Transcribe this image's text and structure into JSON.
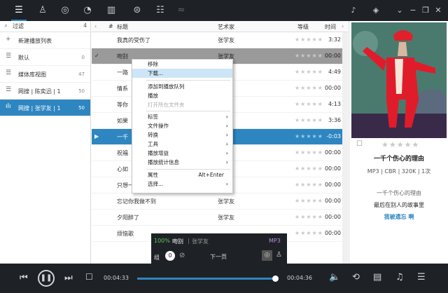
{
  "left": {
    "filter_label": "过滤",
    "filter_count": "4",
    "items": [
      {
        "label": "新建播放列表",
        "count": ""
      },
      {
        "label": "默认",
        "count": "0"
      },
      {
        "label": "媒体库视图",
        "count": "47"
      },
      {
        "label": "网搜 | 陈奕迅 | 1",
        "count": "50"
      },
      {
        "label": "网搜 | 张学友 | 1",
        "count": "50"
      }
    ]
  },
  "table": {
    "col_num": "#",
    "col_title": "标题",
    "col_artist": "艺术家",
    "col_rating": "等级",
    "col_time": "时间",
    "rows": [
      {
        "title": "我真的受伤了",
        "artist": "张学友",
        "time": "3:32"
      },
      {
        "title": "吻别",
        "artist": "张学友",
        "time": "00:00"
      },
      {
        "title": "一路",
        "artist": "",
        "time": "4:49"
      },
      {
        "title": "情系",
        "artist": "",
        "time": "00:00"
      },
      {
        "title": "等你",
        "artist": "",
        "time": "4:13"
      },
      {
        "title": "如果",
        "artist": "",
        "time": "3:36"
      },
      {
        "title": "一千",
        "artist": "",
        "time": "-0:03"
      },
      {
        "title": "祝福",
        "artist": "",
        "time": "00:00"
      },
      {
        "title": "心如",
        "artist": "",
        "time": "00:00"
      },
      {
        "title": "只想一生跟你走",
        "artist": "",
        "time": "00:00"
      },
      {
        "title": "忘记你我做不到",
        "artist": "张学友",
        "time": "00:00"
      },
      {
        "title": "夕阳醉了",
        "artist": "张学友",
        "time": "00:00"
      },
      {
        "title": "烦恼歌",
        "artist": "",
        "time": "00:00"
      }
    ]
  },
  "menu": {
    "items": [
      {
        "label": "移除"
      },
      {
        "label": "下载..."
      },
      {
        "label": "添加到播放队列"
      },
      {
        "label": "播放"
      },
      {
        "label": "打开所在文件夹"
      },
      {
        "label": "标签"
      },
      {
        "label": "文件操作"
      },
      {
        "label": "转换"
      },
      {
        "label": "工具"
      },
      {
        "label": "播放增益"
      },
      {
        "label": "播放统计信息"
      },
      {
        "label": "属性",
        "shortcut": "Alt+Enter"
      },
      {
        "label": "选择..."
      }
    ]
  },
  "right": {
    "song_title": "一千个伤心的理由",
    "format": "MP3 | CBR | 320K | 1次",
    "lyric_1": "一千个伤心的理由",
    "lyric_2": "最后在别人的故事里",
    "lyric_3": "我被遗忘 啊"
  },
  "mini": {
    "percent": "100%",
    "song": "吻别",
    "artist": "张学友",
    "format": "MP3",
    "group_label": "组",
    "group_count": "0",
    "next_page": "下一页"
  },
  "player": {
    "elapsed": "00:04:33",
    "total": "00:04:36",
    "progress": 0.99
  },
  "colors": {
    "accent": "#2e86c1",
    "dark": "#1e2226"
  }
}
